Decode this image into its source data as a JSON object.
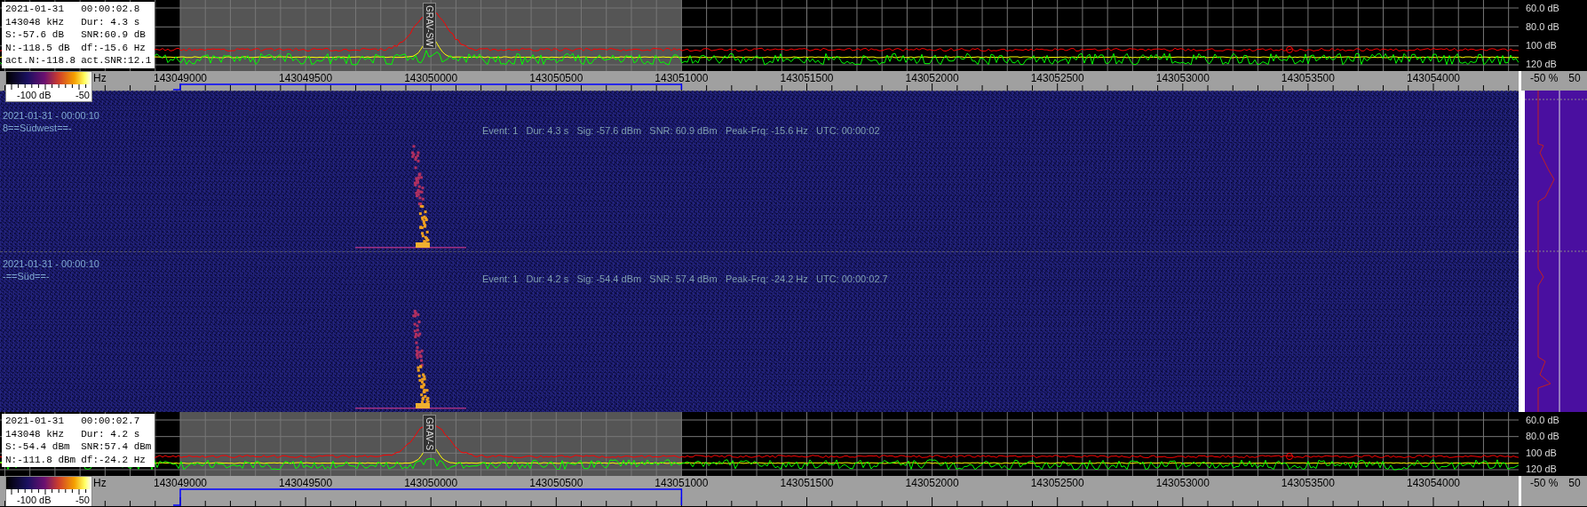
{
  "top_spectrum": {
    "info": [
      {
        "left": "2021-01-31",
        "right": "00:00:02.8"
      },
      {
        "left": "143048 kHz",
        "right": "Dur: 4.3 s"
      },
      {
        "left": "S:-57.6 dB",
        "right": "SNR:60.9 dB"
      },
      {
        "left": "N:-118.5 dB",
        "right": "df:-15.6 Hz"
      },
      {
        "left": "act.N:-118.8",
        "right": "act.SNR:12.1"
      }
    ],
    "marker_label": "GRAV-SW",
    "db_labels": [
      "60.0 dB",
      "80.0 dB",
      "100 dB",
      "120 dB"
    ],
    "scale": {
      "partial_label": "Hz",
      "ticks": [
        "143049000",
        "143049500",
        "143050000",
        "143050500",
        "143051000",
        "143051500",
        "143052000",
        "143052500",
        "143053000",
        "143053500",
        "143054000"
      ],
      "side": [
        "-50 %",
        "50"
      ]
    },
    "colorbar": {
      "low": "-100 dB",
      "high": "-50"
    }
  },
  "waterfall": {
    "events": [
      {
        "timestamp": "2021-01-31 - 00:00:10",
        "station": "8==Südwest==-",
        "summary": "Event: 1   Dur: 4.3 s   Sig: -57.6 dBm   SNR: 60.9 dBm   Peak-Frq: -15.6 Hz   UTC: 00:00:02"
      },
      {
        "timestamp": "2021-01-31 - 00:00:10",
        "station": "-==Süd==-",
        "summary": "Event: 1   Dur: 4.2 s   Sig: -54.4 dBm   SNR: 57.4 dBm   Peak-Frq: -24.2 Hz   UTC: 00:00:02.7"
      }
    ]
  },
  "bottom_spectrum": {
    "info": [
      {
        "left": "2021-01-31",
        "right": "00:00:02.7"
      },
      {
        "left": "143048 kHz",
        "right": "Dur: 4.2 s"
      },
      {
        "left": "S:-54.4 dBm",
        "right": "SNR:57.4 dBm"
      },
      {
        "left": "N:-111.8 dBm",
        "right": "df:-24.2 Hz"
      }
    ],
    "marker_label": "GRAV-S",
    "db_labels": [
      "60.0 dB",
      "80.0 dB",
      "100 dB",
      "120 dB"
    ],
    "scale": {
      "partial_label": "Hz",
      "ticks": [
        "143049000",
        "143049500",
        "143050000",
        "143050500",
        "143051000",
        "143051500",
        "143052000",
        "143052500",
        "143053000",
        "143053500",
        "143054000"
      ],
      "side": [
        "-50 %",
        "50"
      ]
    },
    "colorbar": {
      "low": "-100 dB",
      "high": "-50"
    }
  }
}
